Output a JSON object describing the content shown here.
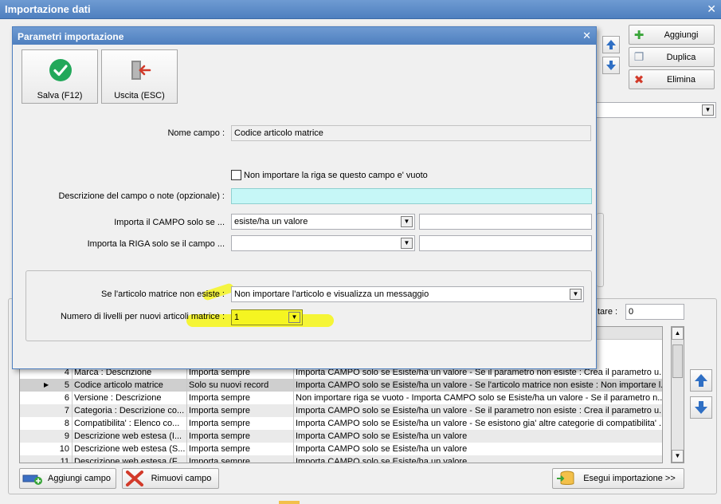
{
  "outer": {
    "title": "Importazione dati",
    "close_glyph": "✕",
    "right_buttons": [
      {
        "label": "Aggiungi",
        "icon": "plus-icon",
        "glyph": "✚",
        "color": "#3aa53a"
      },
      {
        "label": "Duplica",
        "icon": "copy-icon",
        "glyph": "❐",
        "color": "#7a8da6"
      },
      {
        "label": "Elimina",
        "icon": "delete-icon",
        "glyph": "✖",
        "color": "#d23a2a"
      }
    ],
    "partial_label": "tare :",
    "partial_value": "0",
    "grid_rows": [
      {
        "num": "4",
        "field": "Marca : Descrizione",
        "mode": "Importa sempre",
        "note": "Importa CAMPO solo se Esiste/ha un valore  - Se il parametro non esiste : Crea il parametro u..."
      },
      {
        "num": "5",
        "field": "Codice articolo matrice",
        "mode": "Solo su nuovi record",
        "note": "Importa CAMPO solo se Esiste/ha un valore  - Se l'articolo matrice non esiste : Non importare l...",
        "current": true
      },
      {
        "num": "6",
        "field": "Versione : Descrizione",
        "mode": "Importa sempre",
        "note": "Non importare riga se vuoto - Importa CAMPO solo se Esiste/ha un valore  - Se il parametro n..."
      },
      {
        "num": "7",
        "field": "Categoria : Descrizione co...",
        "mode": "Importa sempre",
        "note": "Importa CAMPO solo se Esiste/ha un valore  - Se il parametro non esiste : Crea il parametro u..."
      },
      {
        "num": "8",
        "field": "Compatibilita' : Elenco co...",
        "mode": "Importa sempre",
        "note": "Importa CAMPO solo se Esiste/ha un valore  - Se esistono gia' altre categorie di compatibilita' ..."
      },
      {
        "num": "9",
        "field": "Descrizione web estesa (I...",
        "mode": "Importa sempre",
        "note": "Importa CAMPO solo se Esiste/ha un valore"
      },
      {
        "num": "10",
        "field": "Descrizione web estesa (S...",
        "mode": "Importa sempre",
        "note": "Importa CAMPO solo se Esiste/ha un valore"
      },
      {
        "num": "11",
        "field": "Descrizione web estesa (F...",
        "mode": "Importa sempre",
        "note": "Importa CAMPO solo se Esiste/ha un valore"
      }
    ],
    "bottom_buttons": {
      "add_field": "Aggiungi campo",
      "remove_field": "Rimuovi campo",
      "run_import": "Esegui importazione >>"
    }
  },
  "dialog": {
    "title": "Parametri importazione",
    "close_glyph": "✕",
    "toolbar": {
      "save": "Salva (F12)",
      "exit": "Uscita (ESC)"
    },
    "field_name_label": "Nome campo :",
    "field_name_value": "Codice articolo matrice",
    "skip_if_empty_label": "Non importare la riga se questo campo e' vuoto",
    "skip_if_empty_checked": false,
    "description_label": "Descrizione del campo o note (opzionale) :",
    "description_value": "",
    "import_field_label": "Importa il CAMPO solo se ...",
    "import_field_value": "esiste/ha un valore",
    "import_row_label": "Importa la RIGA solo se il campo ...",
    "import_row_value": "",
    "matrix_missing_label": "Se l'articolo matrice non esiste :",
    "matrix_missing_value": "Non importare l'articolo e visualizza un messaggio",
    "levels_label": "Numero di livelli per nuovi articoli matrice :",
    "levels_value": "1"
  },
  "colors": {
    "title_bar": "#5a88c7",
    "highlight": "#f5f521",
    "check_green": "#22a85a",
    "exit_red": "#d23a2a",
    "arrow_blue": "#2f6fc4"
  }
}
